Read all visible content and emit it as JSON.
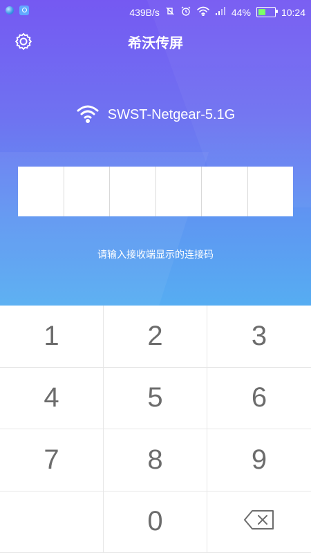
{
  "status_bar": {
    "speed": "439B/s",
    "battery_percent": "44%",
    "battery_level": 0.44,
    "time": "10:24"
  },
  "header": {
    "title": "希沃传屏"
  },
  "wifi": {
    "ssid": "SWST-Netgear-5.1G"
  },
  "code_input": {
    "digits": [
      "",
      "",
      "",
      "",
      "",
      ""
    ],
    "hint": "请输入接收端显示的连接码"
  },
  "keypad": {
    "keys": [
      "1",
      "2",
      "3",
      "4",
      "5",
      "6",
      "7",
      "8",
      "9",
      "",
      "0",
      "backspace"
    ]
  },
  "colors": {
    "gradient_top": "#7559f2",
    "gradient_bottom": "#56adf2",
    "key_text": "#6c6c6c",
    "battery_fill": "#7cff69"
  }
}
